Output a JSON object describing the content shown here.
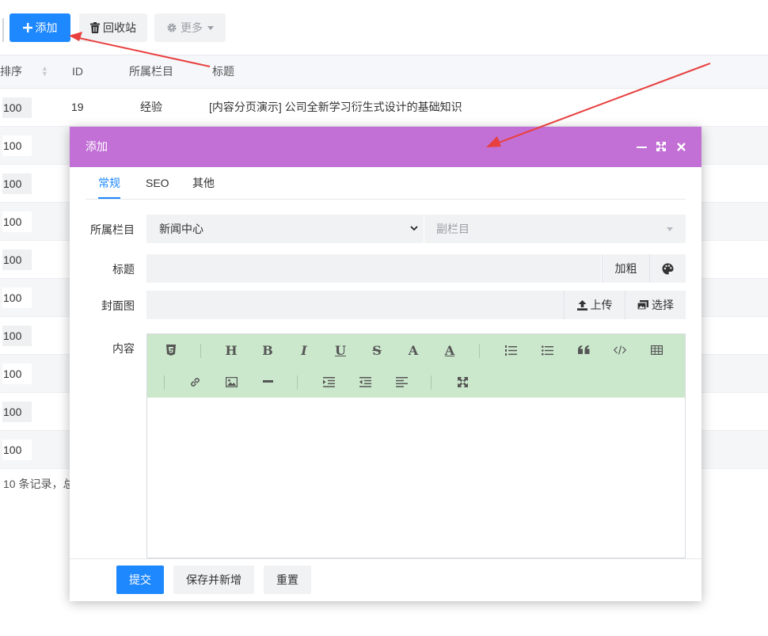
{
  "toolbar": {
    "add_label": "添加",
    "recycle_label": "回收站",
    "more_label": "更多"
  },
  "table": {
    "headers": {
      "sort": "排序",
      "id": "ID",
      "category": "所属栏目",
      "title": "标题"
    },
    "rows": [
      {
        "sort": "100",
        "id": "19",
        "category": "经验",
        "title": "[内容分页演示] 公司全新学习衍生式设计的基础知识"
      },
      {
        "sort": "100"
      },
      {
        "sort": "100"
      },
      {
        "sort": "100"
      },
      {
        "sort": "100"
      },
      {
        "sort": "100"
      },
      {
        "sort": "100"
      },
      {
        "sort": "100"
      },
      {
        "sort": "100"
      },
      {
        "sort": "100"
      }
    ],
    "pager_text": "10 条记录，总"
  },
  "modal": {
    "title": "添加",
    "tabs": [
      "常规",
      "SEO",
      "其他"
    ],
    "active_tab": "常规",
    "fields": {
      "category_label": "所属栏目",
      "category_value": "新闻中心",
      "subcategory_placeholder": "副栏目",
      "title_label": "标题",
      "title_value": "",
      "bold_label": "加粗",
      "cover_label": "封面图",
      "cover_value": "",
      "upload_label": "上传",
      "choose_label": "选择",
      "content_label": "内容"
    },
    "editor_tools_row1": [
      "html5-icon",
      "heading-icon",
      "bold-icon",
      "italic-icon",
      "underline-icon",
      "strikethrough-icon",
      "font-color-icon",
      "background-color-icon",
      "ordered-list-icon",
      "unordered-list-icon",
      "quote-icon",
      "code-icon",
      "table-icon"
    ],
    "editor_tools_row2": [
      "link-icon",
      "image-icon",
      "horizontal-rule-icon",
      "indent-icon",
      "outdent-icon",
      "align-icon",
      "fullscreen-icon"
    ],
    "footer": {
      "submit_label": "提交",
      "save_new_label": "保存并新增",
      "reset_label": "重置"
    }
  },
  "colors": {
    "primary": "#1e88ff",
    "modal_header": "#c270d6",
    "editor_toolbar": "#cbe8cc",
    "annotation_arrow": "#e8403f"
  }
}
